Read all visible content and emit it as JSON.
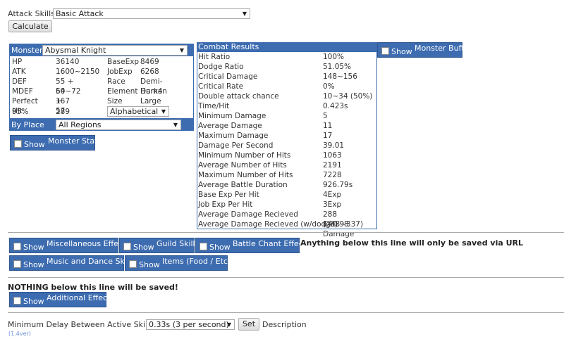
{
  "attack_skills": {
    "label": "Attack Skills:",
    "value": "Basic Attack"
  },
  "calculate_label": "Calculate",
  "monster": {
    "label": "Monster:",
    "value": "Abysmal Knight",
    "stats": [
      {
        "k1": "HP",
        "v1": "36140",
        "k2": "BaseExp",
        "v2": "8469"
      },
      {
        "k1": "ATK",
        "v1": "1600~2150",
        "k2": "JobExp",
        "v2": "6268"
      },
      {
        "k1": "DEF",
        "v1": "55 + 64~72",
        "k2": "Race",
        "v2": "Demi-Human"
      },
      {
        "k1": "MDEF",
        "v1": "50 + 57",
        "k2": "Element",
        "v2": "Dark4"
      },
      {
        "k1": "Perfect Hit",
        "v1": "167",
        "k2": "Size",
        "v2": "Large"
      }
    ],
    "dodge_label": "95% Dodge",
    "dodge_value": "289",
    "sort_value": "Alphabetical",
    "by_place_label": "By Place",
    "region_value": "All Regions"
  },
  "show_label": "Show",
  "toggles": {
    "monster_state": "Monster State",
    "monster_buffs": "Monster Buffs",
    "misc": "Miscellaneous Effects",
    "guild": "Guild Skills",
    "battle_chant": "Battle Chant Effects",
    "music_dance": "Music and Dance Skills",
    "items": "Items (Food / Etc.)",
    "additional": "Additional Effects"
  },
  "combat": {
    "header": "Combat Results",
    "rows": [
      {
        "k": "Hit Ratio",
        "v": "100%"
      },
      {
        "k": "Dodge Ratio",
        "v": "51.05%"
      },
      {
        "k": "Critical Damage",
        "v": "148~156"
      },
      {
        "k": "Critical Rate",
        "v": "0%"
      },
      {
        "k": "Double attack chance",
        "v": "10~34 (50%)"
      },
      {
        "k": "Time/Hit",
        "v": "0.423s"
      },
      {
        "k": "Minimum Damage",
        "v": "5"
      },
      {
        "k": "Average Damage",
        "v": "11"
      },
      {
        "k": "Maximum Damage",
        "v": "17"
      },
      {
        "k": "Damage Per Second",
        "v": "39.01"
      },
      {
        "k": "Minimum Number of Hits",
        "v": "1063"
      },
      {
        "k": "Average Number of Hits",
        "v": "2191"
      },
      {
        "k": "Maximum Number of Hits",
        "v": "7228"
      },
      {
        "k": "Average Battle Duration",
        "v": "926.79s"
      },
      {
        "k": "Base Exp Per Hit",
        "v": "4Exp"
      },
      {
        "k": "Job Exp Per Hit",
        "v": "3Exp"
      },
      {
        "k": "Average Damage Recieved",
        "v": "288 (238~337)"
      },
      {
        "k": "Average Damage Recieved (w/dodge)",
        "v": "140.98 Damage"
      }
    ]
  },
  "notes": {
    "url_note": "Anything below this line will only be saved via URL",
    "nothing_note": "NOTHING below this line will be saved!"
  },
  "delay": {
    "label": "Minimum Delay Between Active Skills",
    "value": "0.33s (3 per second)",
    "set_label": "Set",
    "description": "Description"
  },
  "version": "(1.4ver)"
}
